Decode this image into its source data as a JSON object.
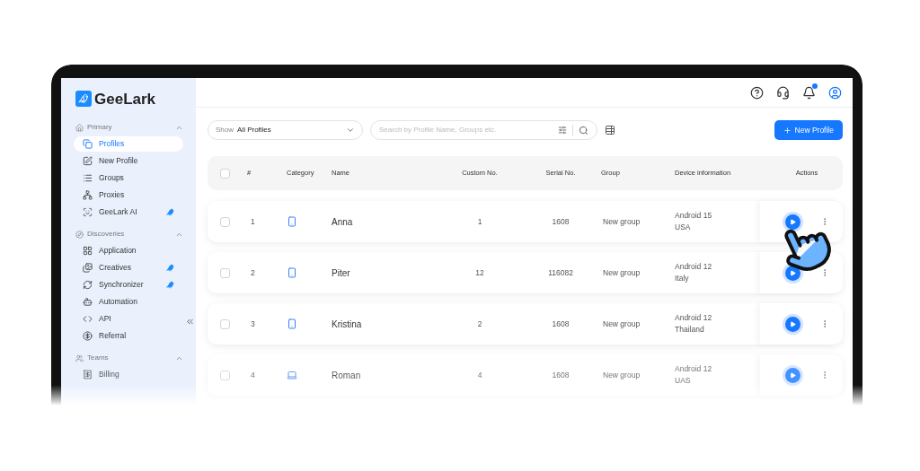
{
  "app": {
    "logo": "GeeLark"
  },
  "sidebar": {
    "sections": [
      {
        "title": "Primary",
        "expanded": true,
        "items": [
          {
            "label": "Profiles",
            "selected": true,
            "ai_badge": false
          },
          {
            "label": "New Profile",
            "selected": false,
            "ai_badge": false
          },
          {
            "label": "Groups",
            "selected": false,
            "ai_badge": false
          },
          {
            "label": "Proxies",
            "selected": false,
            "ai_badge": false
          },
          {
            "label": "GeeLark AI",
            "selected": false,
            "ai_badge": true
          }
        ]
      },
      {
        "title": "Discoveries",
        "expanded": true,
        "items": [
          {
            "label": "Application",
            "selected": false,
            "ai_badge": false
          },
          {
            "label": "Creatives",
            "selected": false,
            "ai_badge": true
          },
          {
            "label": "Synchronizer",
            "selected": false,
            "ai_badge": true
          },
          {
            "label": "Automation",
            "selected": false,
            "ai_badge": false
          },
          {
            "label": "API",
            "selected": false,
            "ai_badge": false
          },
          {
            "label": "Referral",
            "selected": false,
            "ai_badge": false
          }
        ]
      },
      {
        "title": "Teams",
        "expanded": true,
        "items": [
          {
            "label": "Billing",
            "selected": false,
            "ai_badge": false
          }
        ]
      }
    ]
  },
  "header": {
    "notification_dot": true
  },
  "toolbar": {
    "show_label": "Show",
    "show_value": "All Profiles",
    "search": {
      "placeholder": "Search by Profile Name, Groups etc."
    },
    "new_button": "New Profile"
  },
  "table": {
    "columns": [
      "#",
      "Category",
      "Name",
      "Custom No.",
      "Serial No.",
      "Group",
      "Device information",
      "Actions"
    ],
    "header_checked": false,
    "rows": [
      {
        "checked": false,
        "index": "1",
        "kind": "phone",
        "name": "Anna",
        "custom_no": "1",
        "serial_no": "1608",
        "group": "New group",
        "os": "Android 15",
        "country": "USA"
      },
      {
        "checked": false,
        "index": "2",
        "kind": "phone",
        "name": "Piter",
        "custom_no": "12",
        "serial_no": "116082",
        "group": "New group",
        "os": "Android 12",
        "country": "Italy"
      },
      {
        "checked": false,
        "index": "3",
        "kind": "phone",
        "name": "Kristina",
        "custom_no": "2",
        "serial_no": "1608",
        "group": "New group",
        "os": "Android 12",
        "country": "Thailand"
      },
      {
        "checked": false,
        "index": "4",
        "kind": "laptop",
        "name": "Roman",
        "custom_no": "4",
        "serial_no": "1608",
        "group": "New group",
        "os": "Android 12",
        "country": "UAS"
      }
    ]
  }
}
